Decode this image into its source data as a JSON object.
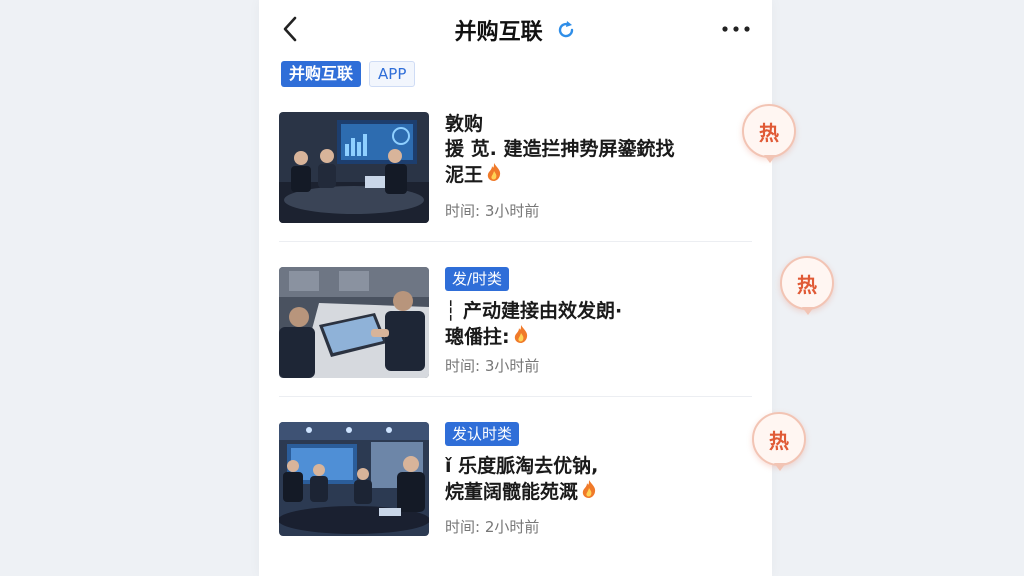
{
  "header": {
    "title": "并购互联",
    "back_icon": "chevron-left-icon",
    "refresh_icon": "refresh-icon",
    "more_icon": "more-horizontal-icon"
  },
  "tags": {
    "main_label": "并购互联",
    "app_label": "APP"
  },
  "hot_label": "热",
  "colors": {
    "accent": "#2f6ed8",
    "hot": "#e05a36"
  },
  "articles": [
    {
      "badge": "",
      "headline": "敦购\n援 苋. 建造拦抻势屏鎏銃找\n泥王",
      "time": "时间: 3小时前"
    },
    {
      "badge": "发/时类",
      "headline": "┆ 产动建接由效发朗·\n璁僠拄:",
      "time": "时间: 3小时前"
    },
    {
      "badge": "发认时类",
      "headline": "ǐ 乐度脈淘去优钠,\n烷董阔髋能苑溉",
      "time": "时间: 2小时前"
    }
  ]
}
